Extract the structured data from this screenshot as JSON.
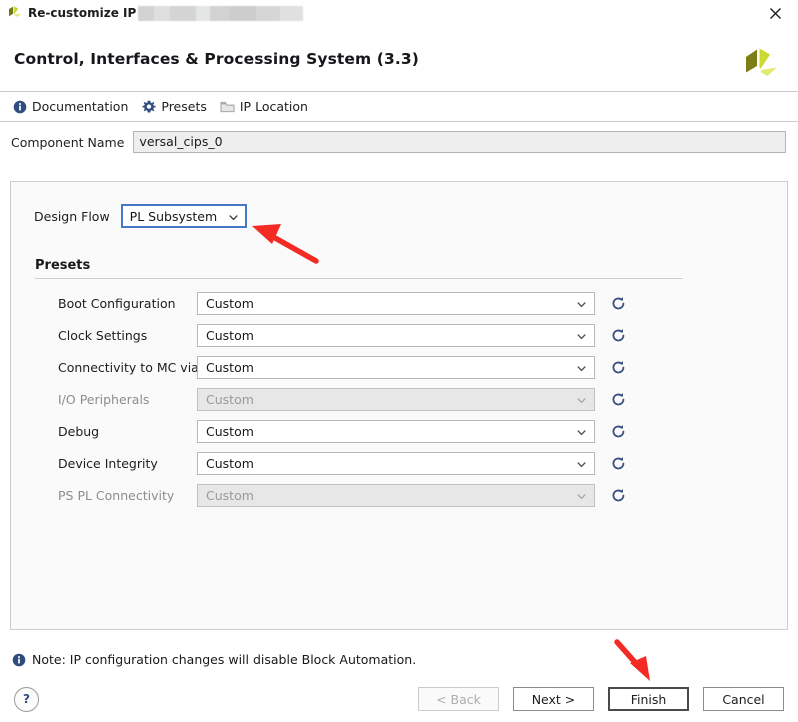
{
  "window": {
    "title": "Re-customize IP",
    "title_redacted": true,
    "close_icon": "close-icon",
    "app_logo_icon": "xilinx-pinwheel-logo"
  },
  "header": {
    "title": "Control, Interfaces & Processing System (3.3)",
    "logo_icon": "xilinx-pinwheel-logo"
  },
  "toolbar": {
    "items": [
      {
        "label": "Documentation",
        "icon": "info-icon"
      },
      {
        "label": "Presets",
        "icon": "gear-icon"
      },
      {
        "label": "IP Location",
        "icon": "folder-icon"
      }
    ]
  },
  "component_name": {
    "label": "Component Name",
    "value": "versal_cips_0"
  },
  "design_flow": {
    "label": "Design Flow",
    "value": "PL Subsystem",
    "focused": true
  },
  "presets": {
    "title": "Presets",
    "refresh_icon": "refresh-icon",
    "rows": [
      {
        "label": "Boot Configuration",
        "value": "Custom",
        "disabled": false
      },
      {
        "label": "Clock Settings",
        "value": "Custom",
        "disabled": false
      },
      {
        "label": "Connectivity to MC via NoC",
        "value": "Custom",
        "disabled": false
      },
      {
        "label": "I/O Peripherals",
        "value": "Custom",
        "disabled": true
      },
      {
        "label": "Debug",
        "value": "Custom",
        "disabled": false
      },
      {
        "label": "Device Integrity",
        "value": "Custom",
        "disabled": false
      },
      {
        "label": "PS PL Connectivity",
        "value": "Custom",
        "disabled": true
      }
    ]
  },
  "note": {
    "icon": "info-icon",
    "text": "Note: IP configuration changes will disable Block Automation."
  },
  "footer": {
    "help_label": "?",
    "buttons": [
      {
        "label": "< Back",
        "disabled": true,
        "default": false
      },
      {
        "label": "Next >",
        "disabled": false,
        "default": false
      },
      {
        "label": "Finish",
        "disabled": false,
        "default": true
      },
      {
        "label": "Cancel",
        "disabled": false,
        "default": false
      }
    ]
  },
  "annotations": {
    "arrow_color": "#f42a24",
    "arrows": [
      {
        "name": "arrow-to-design-flow",
        "points_to": "design-flow-dropdown"
      },
      {
        "name": "arrow-to-finish",
        "points_to": "finish-button"
      }
    ]
  },
  "colors": {
    "accent_blue": "#4577c4",
    "icon_blue": "#2e4c7e",
    "logo_green": "#b5c32a",
    "arrow_red": "#f42a24"
  }
}
